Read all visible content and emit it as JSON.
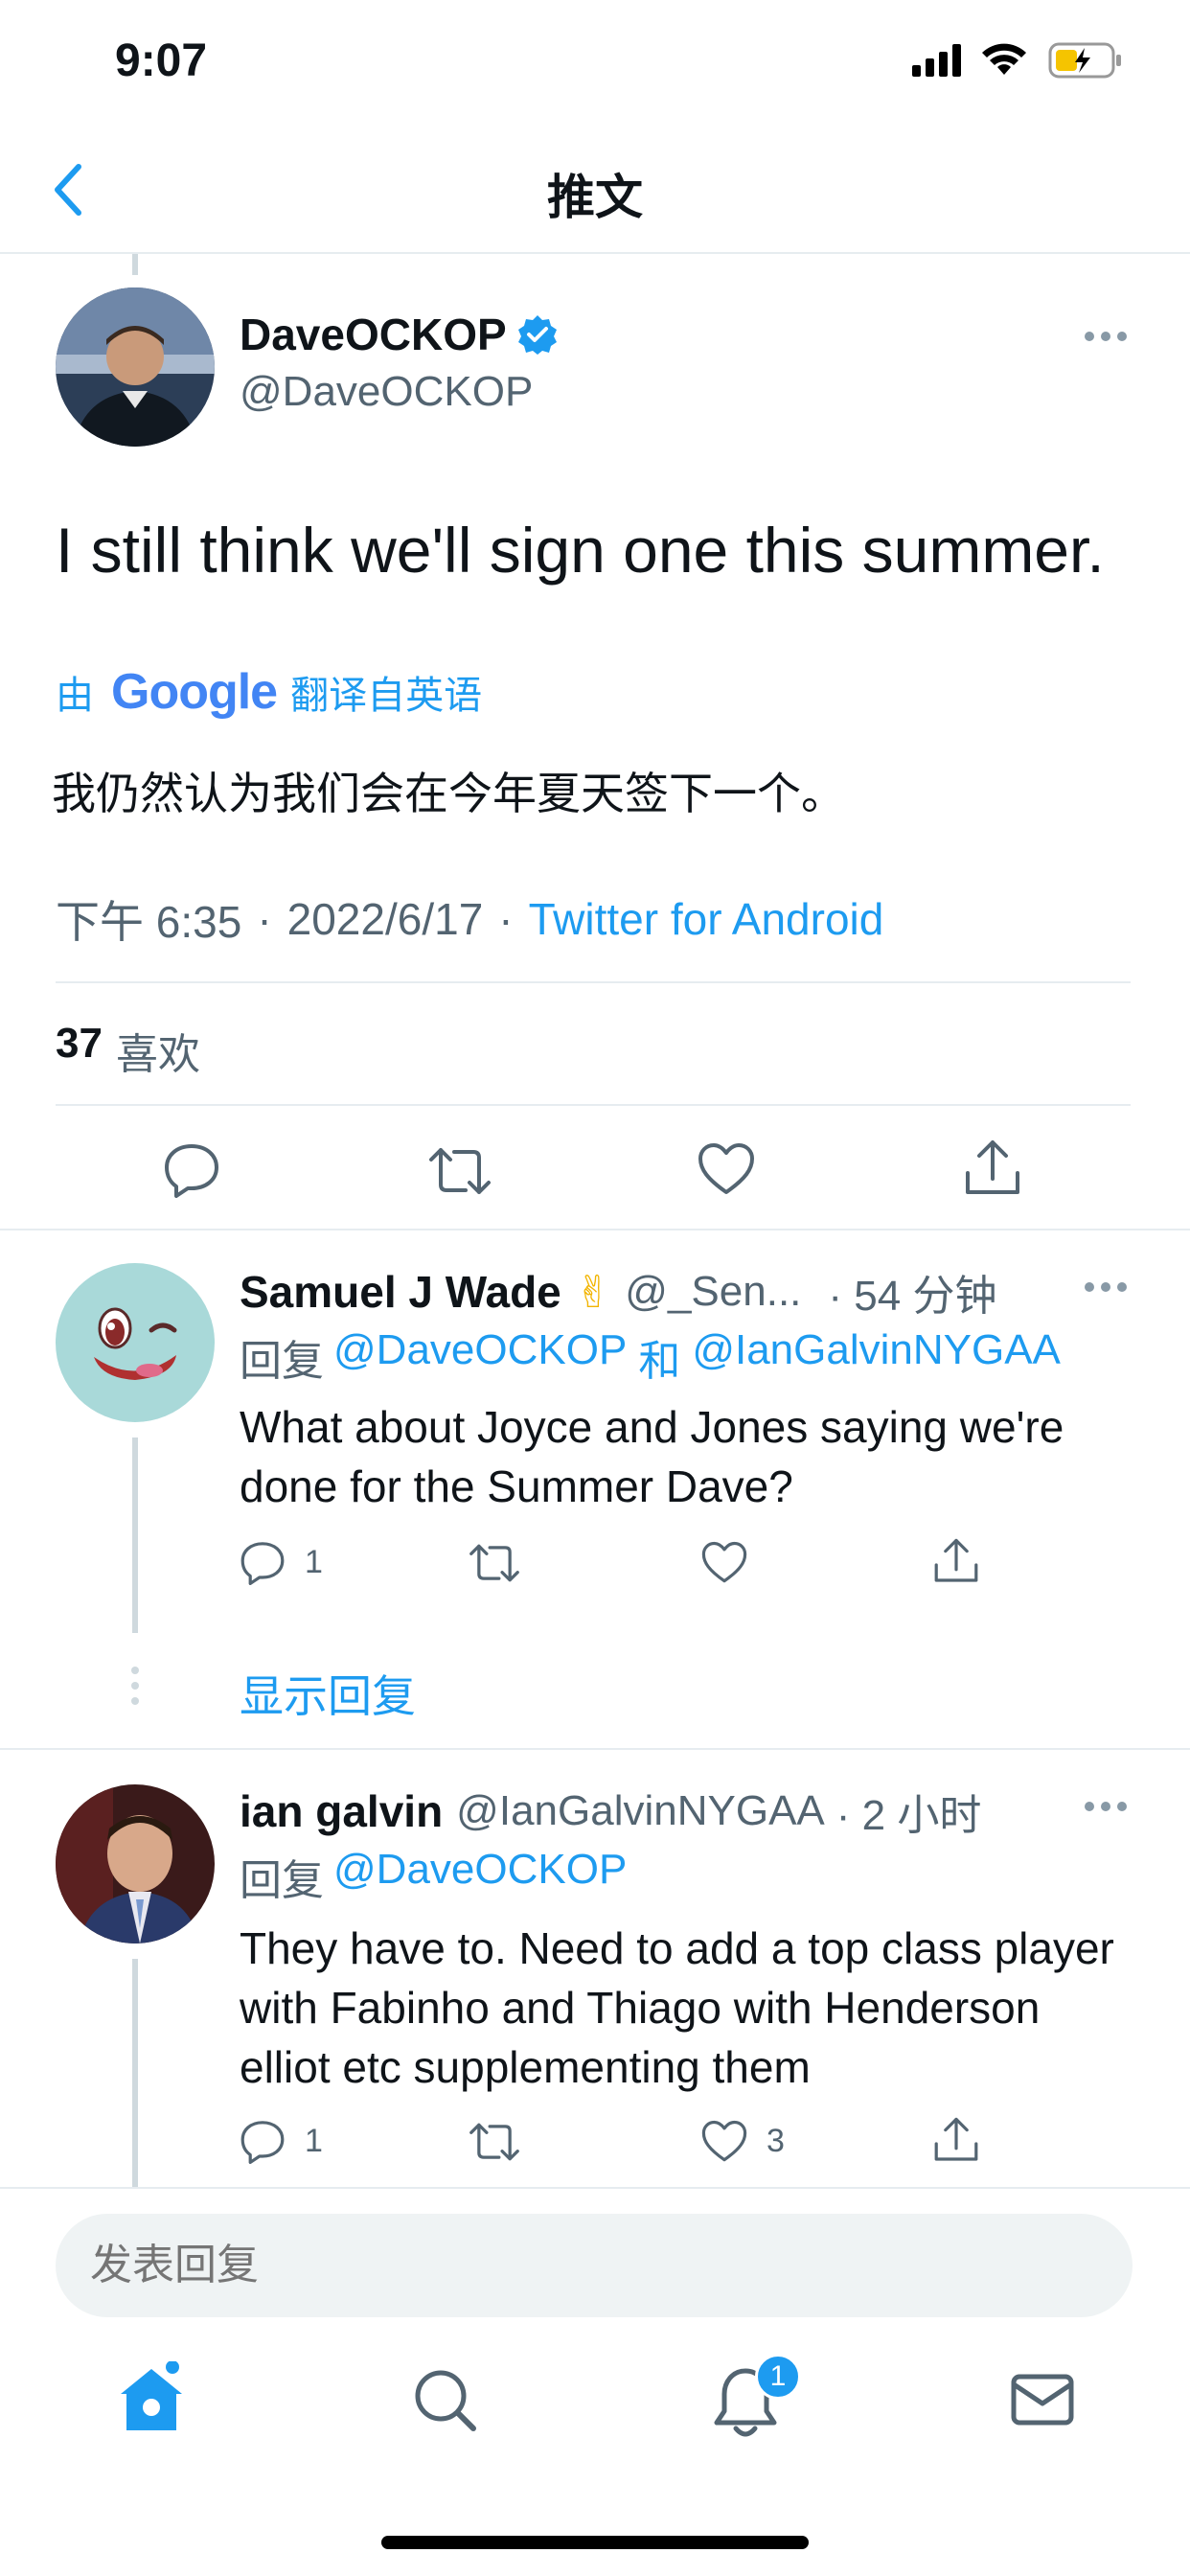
{
  "status_bar": {
    "time": "9:07"
  },
  "header": {
    "title": "推文"
  },
  "tweet": {
    "author_name": "DaveOCKOP",
    "author_handle": "@DaveOCKOP",
    "text": "I still think we'll sign one this summer.",
    "translation_prefix": "由",
    "translation_brand": "Google",
    "translation_suffix": "翻译自英语",
    "translated_text": "我仍然认为我们会在今年夏天签下一个。",
    "time": "下午 6:35",
    "date": "2022/6/17",
    "source": "Twitter for Android",
    "likes_count": "37",
    "likes_label": "喜欢"
  },
  "replies": [
    {
      "name": "Samuel J Wade",
      "emoji": "✌",
      "handle": "@_Sen...",
      "time": "· 54 分钟",
      "reply_label": "回复",
      "reply_to_1": "@DaveOCKOP",
      "reply_joiner": "和",
      "reply_to_2": "@IanGalvinNYGAA",
      "text": "What about Joyce and Jones saying we're done for the Summer Dave?",
      "reply_count": "1",
      "retweet_count": "",
      "like_count": ""
    },
    {
      "name": "ian galvin",
      "handle": "@IanGalvinNYGAA",
      "time": "· 2 小时",
      "reply_label": "回复",
      "reply_to_1": "@DaveOCKOP",
      "text": "They have to. Need to add a top class player with Fabinho and Thiago with Henderson elliot etc supplementing them",
      "reply_count": "1",
      "retweet_count": "",
      "like_count": "3"
    }
  ],
  "show_replies": "显示回复",
  "compose": {
    "placeholder": "发表回复"
  },
  "tab_bar": {
    "notifications_badge": "1"
  },
  "colors": {
    "accent": "#1d9bf0",
    "text": "#0f1419",
    "secondary": "#536471",
    "divider": "#e6ecf0"
  }
}
